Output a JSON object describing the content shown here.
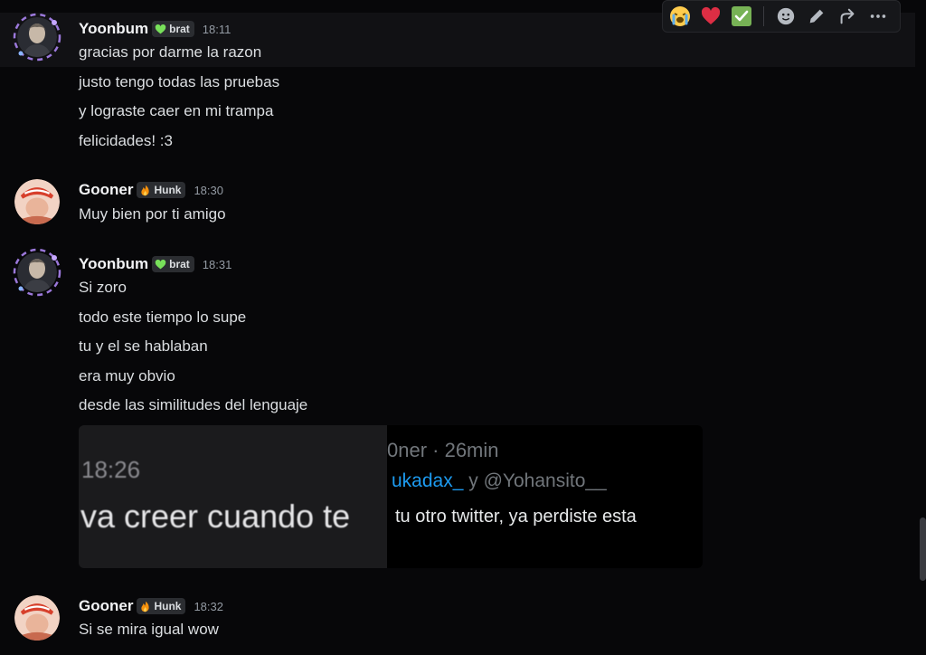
{
  "toolbar": {
    "reactions": [
      "loudly-crying-emoji",
      "red-heart-emoji",
      "check-mark-emoji"
    ],
    "actions": [
      "add-reaction-icon",
      "edit-icon",
      "forward-icon",
      "more-icon"
    ]
  },
  "messages": [
    {
      "username": "Yoonbum",
      "tag": "brat",
      "tag_icon": "green-heart-icon",
      "time": "18:11",
      "lines": [
        "gracias por darme la razon",
        "justo tengo todas las pruebas",
        "y lograste caer en mi trampa",
        "felicidades! :3"
      ]
    },
    {
      "username": "Gooner",
      "tag": "Hunk",
      "tag_icon": "fire-icon",
      "time": "18:30",
      "lines": [
        "Muy bien por ti amigo"
      ]
    },
    {
      "username": "Yoonbum",
      "tag": "brat",
      "tag_icon": "green-heart-icon",
      "time": "18:31",
      "lines": [
        "Si zoro",
        "todo este tiempo lo supe",
        "tu y el se hablaban",
        "era muy obvio",
        "desde las similitudes del lenguaje"
      ]
    },
    {
      "username": "Gooner",
      "tag": "Hunk",
      "tag_icon": "fire-icon",
      "time": "18:32",
      "lines": [
        "Si se mira igual wow"
      ]
    }
  ],
  "embed": {
    "left_time": "18:26",
    "left_text": "va creer cuando te",
    "right_header": "0ner · 26min",
    "right_mention": "ukadax_",
    "right_mention_rest": " y @Yohansito__",
    "right_text": "tu otro twitter, ya perdiste esta"
  },
  "colors": {
    "background": "#070709",
    "username": "#f2f3f5",
    "text": "#dbdee1",
    "timestamp": "#949ba4",
    "mention": "#1d9bf0"
  }
}
